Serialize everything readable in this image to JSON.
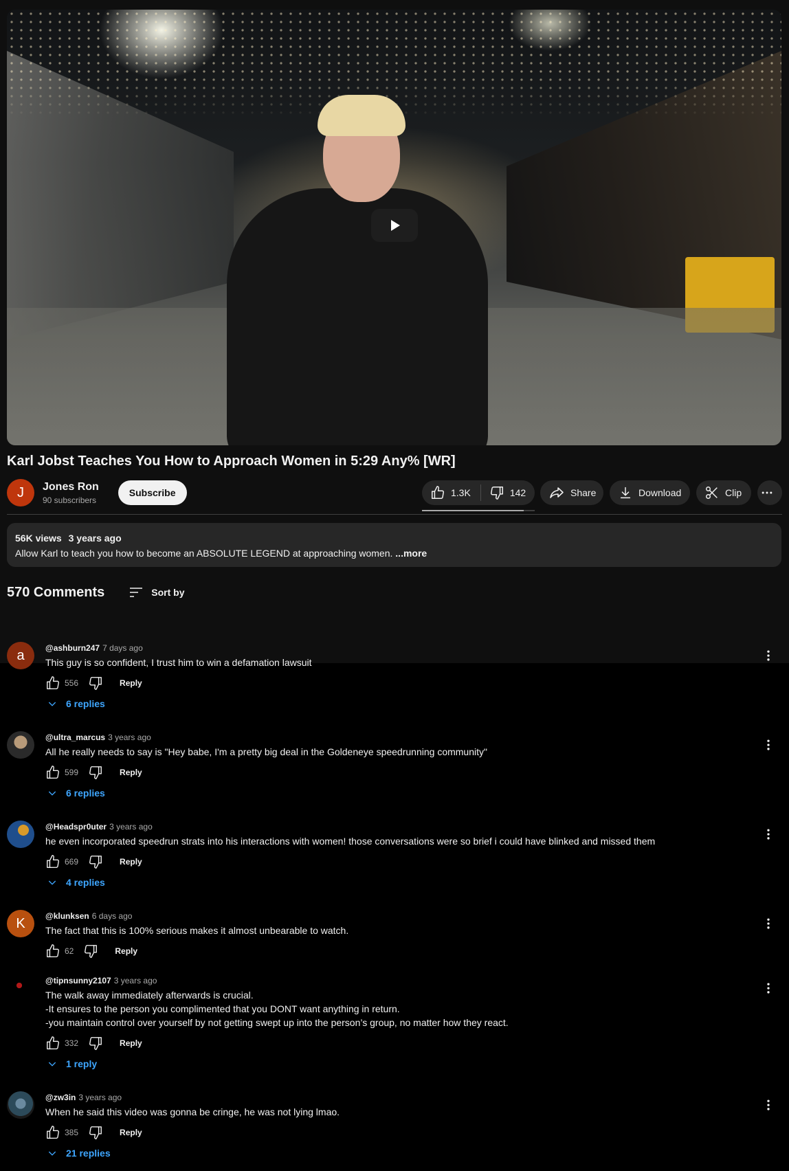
{
  "video": {
    "title": "Karl Jobst Teaches You How to Approach Women in 5:29 Any% [WR]",
    "like_ratio": 0.9
  },
  "channel": {
    "initial": "J",
    "name": "Jones Ron",
    "subscribers": "90 subscribers",
    "subscribe_label": "Subscribe"
  },
  "actions": {
    "likes": "1.3K",
    "dislikes": "142",
    "share": "Share",
    "download": "Download",
    "clip": "Clip"
  },
  "description": {
    "views": "56K views",
    "age": "3 years ago",
    "text": "Allow Karl to teach you how to become an ABSOLUTE LEGEND at approaching women.",
    "more": "...more"
  },
  "comments_header": {
    "count": "570 Comments",
    "sort_label": "Sort by"
  },
  "comments": [
    {
      "avatar_initial": "a",
      "avatar_color": "#bf360c",
      "author": "@ashburn247",
      "time": "7 days ago",
      "text": "This guy is so confident, I trust him to win a defamation lawsuit",
      "likes": "556",
      "reply": "Reply",
      "replies": "6 replies"
    },
    {
      "avatar_initial": "",
      "avatar_color": "#3a3f3a",
      "author": "@ultra_marcus",
      "time": "3 years ago",
      "text": "All he really needs to say is \"Hey babe, I'm a pretty big deal in the Goldeneye speedrunning community\"",
      "likes": "599",
      "reply": "Reply",
      "replies": "6 replies"
    },
    {
      "avatar_initial": "",
      "avatar_color": "#1f4e8c",
      "author": "@Headspr0uter",
      "time": "3 years ago",
      "text": "he even incorporated speedrun strats into his interactions with women! those conversations were so brief i could have blinked and missed them",
      "likes": "669",
      "reply": "Reply",
      "replies": "4 replies"
    },
    {
      "avatar_initial": "K",
      "avatar_color": "#b8500f",
      "author": "@klunksen",
      "time": "6 days ago",
      "text": "The fact that this is 100% serious makes it almost unbearable to watch.",
      "likes": "62",
      "reply": "Reply",
      "replies": ""
    },
    {
      "avatar_initial": "",
      "avatar_color": "#000000",
      "author": "@tipnsunny2107",
      "time": "3 years ago",
      "text": "The walk away immediately afterwards is crucial.\n-It ensures to the person you complimented that you DONT want anything in return.\n-you maintain control over yourself by not getting swept up into the person’s group, no matter how they react.",
      "likes": "332",
      "reply": "Reply",
      "replies": "1 reply"
    },
    {
      "avatar_initial": "",
      "avatar_color": "#2c4a5a",
      "author": "@zw3in",
      "time": "3 years ago",
      "text": "When he said this video was gonna be cringe, he was not lying lmao.",
      "likes": "385",
      "reply": "Reply",
      "replies": "21 replies"
    }
  ],
  "icons": {
    "play": "play-icon",
    "like": "thumb-up-icon",
    "dislike": "thumb-down-icon",
    "share": "share-icon",
    "download": "download-icon",
    "clip": "scissors-icon",
    "more": "more-horizontal-icon",
    "sort": "sort-icon",
    "kebab": "more-vertical-icon",
    "expand": "chevron-down-icon"
  }
}
